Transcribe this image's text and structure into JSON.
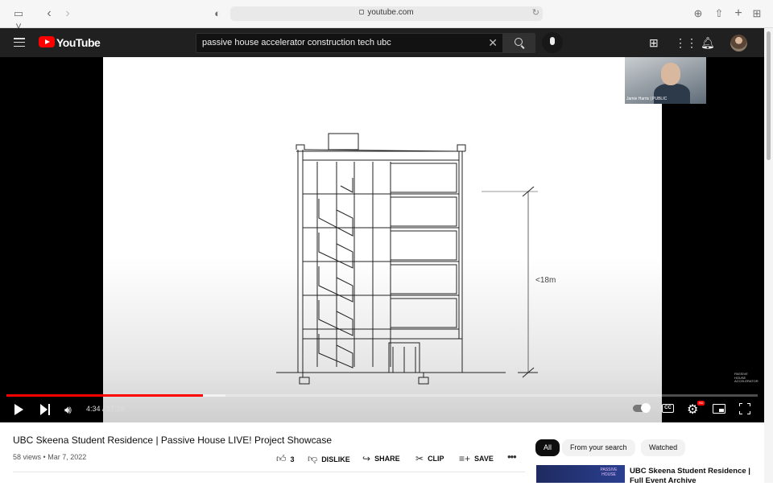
{
  "browser": {
    "url": "youtube.com"
  },
  "masthead": {
    "logo_text": "YouTube",
    "search_query": "passive house accelerator construction tech ubc"
  },
  "player": {
    "webcam_name": "Jamie Harris | PUBLIC",
    "dimension_label": "<18m",
    "watermark": "PASSIVE HOUSE ACCELERATOR",
    "current_time": "4:34",
    "duration": "17:28",
    "played_fraction": 0.262,
    "buffered_fraction": 0.291
  },
  "video": {
    "title": "UBC Skeena Student Residence | Passive House LIVE! Project Showcase",
    "views": "58 views",
    "date": "Mar 7, 2022",
    "meta_separator": "•"
  },
  "actions": {
    "likes": "3",
    "dislike": "DISLIKE",
    "share": "SHARE",
    "clip": "CLIP",
    "save": "SAVE",
    "more": "•••"
  },
  "filters": {
    "chips": [
      "All",
      "From your search",
      "Watched"
    ]
  },
  "recommendations": [
    {
      "title": "UBC Skeena Student Residence | Full Event Archive",
      "thumb_text": "PASSIVE HOUSE"
    }
  ]
}
